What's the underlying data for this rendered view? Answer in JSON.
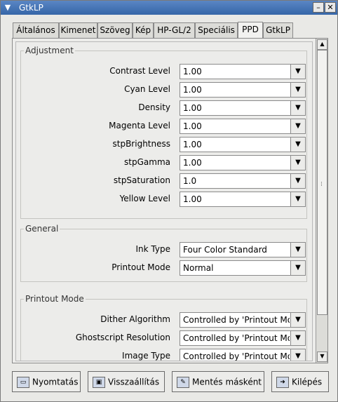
{
  "window": {
    "title": "GtkLP"
  },
  "tabs": [
    {
      "label": "Általános"
    },
    {
      "label": "Kimenet"
    },
    {
      "label": "Szöveg"
    },
    {
      "label": "Kép"
    },
    {
      "label": "HP-GL/2"
    },
    {
      "label": "Speciális"
    },
    {
      "label": "PPD",
      "active": true
    },
    {
      "label": "GtkLP"
    }
  ],
  "groups": {
    "adjustment": {
      "title": "Adjustment",
      "rows": [
        {
          "label": "Contrast Level",
          "value": "1.00"
        },
        {
          "label": "Cyan Level",
          "value": "1.00"
        },
        {
          "label": "Density",
          "value": "1.00"
        },
        {
          "label": "Magenta Level",
          "value": "1.00"
        },
        {
          "label": "stpBrightness",
          "value": "1.00"
        },
        {
          "label": "stpGamma",
          "value": "1.00"
        },
        {
          "label": "stpSaturation",
          "value": "1.0"
        },
        {
          "label": "Yellow Level",
          "value": "1.00"
        }
      ]
    },
    "general": {
      "title": "General",
      "rows": [
        {
          "label": "Ink Type",
          "value": "Four Color Standard"
        },
        {
          "label": "Printout Mode",
          "value": "Normal"
        }
      ]
    },
    "printout_mode": {
      "title": "Printout Mode",
      "rows": [
        {
          "label": "Dither Algorithm",
          "value": "Controlled by 'Printout Mode'"
        },
        {
          "label": "Ghostscript Resolution",
          "value": "Controlled by 'Printout Mode'"
        },
        {
          "label": "Image Type",
          "value": "Controlled by 'Printout Mode'"
        }
      ]
    }
  },
  "buttons": {
    "print": "Nyomtatás",
    "reset": "Visszaállítás",
    "save_as": "Mentés másként",
    "quit": "Kilépés"
  },
  "icons": {
    "window_menu": "chevron-down-icon",
    "minimize": "minimize-icon",
    "close": "close-icon",
    "print": "printer-icon",
    "reset": "floppy-restore-icon",
    "save_as": "save-edit-icon",
    "quit": "exit-icon"
  }
}
